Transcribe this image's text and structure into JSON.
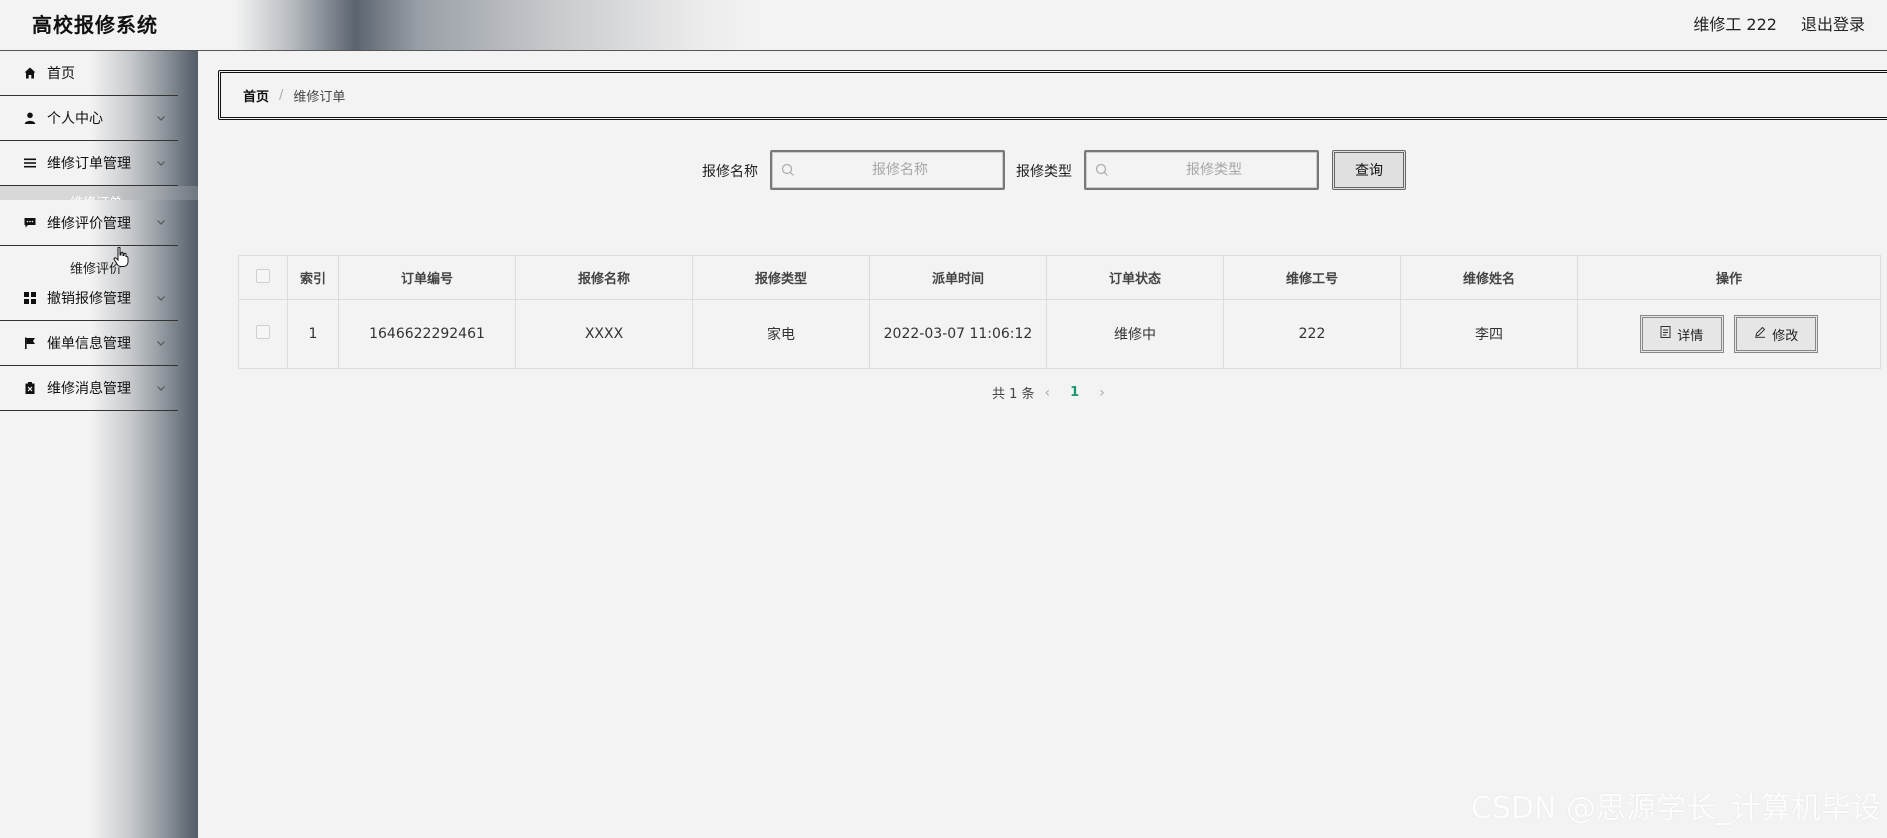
{
  "header": {
    "app_title": "高校报修系统",
    "user_label": "维修工 222",
    "logout_label": "退出登录"
  },
  "sidebar": {
    "items": [
      {
        "label": "首页",
        "icon": "home-icon"
      },
      {
        "label": "个人中心",
        "icon": "user-icon"
      },
      {
        "label": "维修订单管理",
        "icon": "list-icon"
      },
      {
        "label": "维修评价管理",
        "icon": "comment-icon"
      },
      {
        "label": "撤销报修管理",
        "icon": "grid-icon"
      },
      {
        "label": "催单信息管理",
        "icon": "flag-icon"
      },
      {
        "label": "维修消息管理",
        "icon": "clipboard-icon"
      }
    ],
    "submenu_strip_label": "维修订单",
    "submenu_item_label": "维修评价"
  },
  "breadcrumb": {
    "home": "首页",
    "separator": "/",
    "current": "维修订单"
  },
  "search": {
    "name_label": "报修名称",
    "name_placeholder": "报修名称",
    "type_label": "报修类型",
    "type_placeholder": "报修类型",
    "query_button": "查询"
  },
  "table": {
    "columns": [
      "索引",
      "订单编号",
      "报修名称",
      "报修类型",
      "派单时间",
      "订单状态",
      "维修工号",
      "维修姓名",
      "操作"
    ],
    "rows": [
      {
        "index": "1",
        "order_no": "1646622292461",
        "repair_name": "XXXX",
        "repair_type": "家电",
        "dispatch_time": "2022-03-07 11:06:12",
        "status": "维修中",
        "worker_no": "222",
        "worker_name": "李四",
        "detail_label": "详情",
        "edit_label": "修改"
      }
    ]
  },
  "pagination": {
    "total_label": "共 1 条",
    "current_page": "1"
  },
  "watermark": "CSDN @思源学长_计算机毕设",
  "colors": {
    "accent": "#1a9a6c",
    "sidebar_dark": "#555e68"
  }
}
